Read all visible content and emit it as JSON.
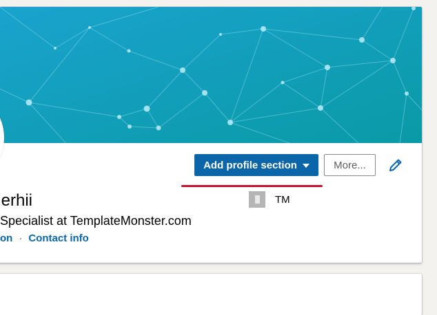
{
  "profile": {
    "name_fragment": "erhii",
    "headline_fragment": "Specialist at TemplateMonster.com",
    "links": {
      "partial_label": "on",
      "separator": "·",
      "contact_info": "Contact info"
    },
    "company": {
      "name": "TM",
      "logo_icon": "building-icon"
    }
  },
  "actions": {
    "add_profile_section": "Add profile section",
    "more": "More...",
    "edit_icon": "pencil-icon"
  },
  "colors": {
    "primary": "#0a66a8",
    "underline": "#c8102e",
    "banner_start": "#1a9ccf",
    "banner_end": "#0a98a4"
  }
}
